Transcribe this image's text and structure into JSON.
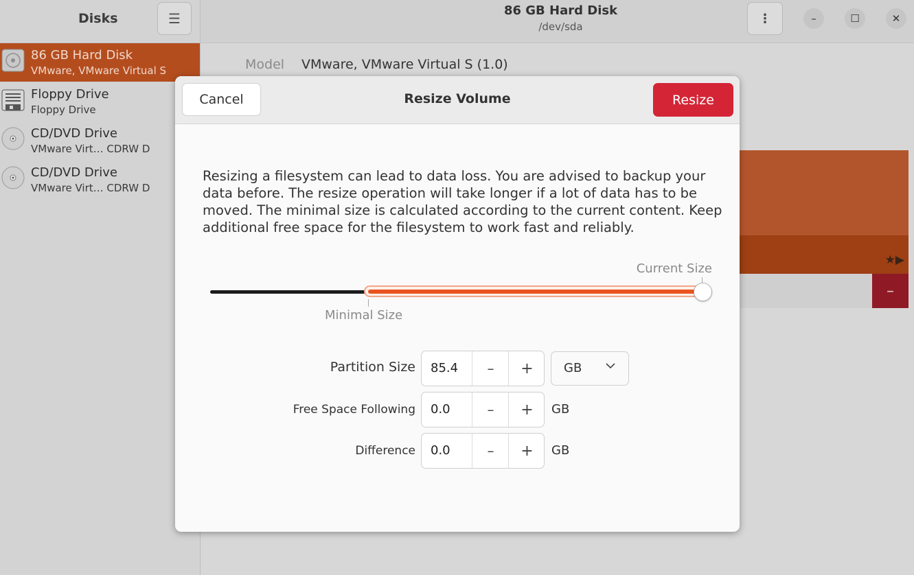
{
  "sidebar": {
    "title": "Disks",
    "drives": [
      {
        "name": "86 GB Hard Disk",
        "sub": "VMware, VMware Virtual S"
      },
      {
        "name": "Floppy Drive",
        "sub": "Floppy Drive"
      },
      {
        "name": "CD/DVD Drive",
        "sub": "VMware Virt…   CDRW D"
      },
      {
        "name": "CD/DVD Drive",
        "sub": "VMware Virt…   CDRW D"
      }
    ]
  },
  "header": {
    "title": "86 GB Hard Disk",
    "subtitle": "/dev/sda",
    "minimize": "–",
    "maximize": "☐",
    "close": "✕"
  },
  "details": {
    "model_label": "Model",
    "model_value": "VMware, VMware Virtual S (1.0)"
  },
  "volume_bar": {
    "icons": "★▶",
    "minus": "–"
  },
  "dialog": {
    "title": "Resize Volume",
    "cancel_label": "Cancel",
    "resize_label": "Resize",
    "warning": "Resizing a filesystem can lead to data loss. You are advised to backup your data before. The resize operation will take longer if a lot of data has to be moved. The minimal size is calculated according to the current content. Keep additional free space for the filesystem to work fast and reliably.",
    "slider": {
      "current_label": "Current Size",
      "minimal_label": "Minimal Size"
    },
    "fields": {
      "partition_size": {
        "label": "Partition Size",
        "value": "85.4",
        "unit": "GB"
      },
      "free_space_following": {
        "label": "Free Space Following",
        "value": "0.0",
        "unit": "GB"
      },
      "difference": {
        "label": "Difference",
        "value": "0.0",
        "unit": "GB"
      }
    },
    "spin_minus": "–",
    "spin_plus": "+"
  },
  "colors": {
    "accent": "#e9541f",
    "destructive": "#d42536",
    "selected_row": "#b44d1e"
  }
}
